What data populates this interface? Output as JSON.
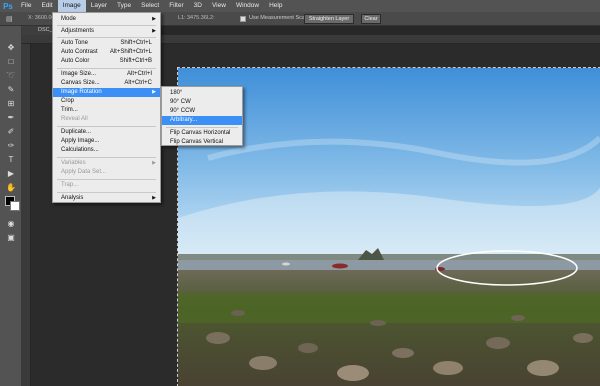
{
  "menubar": {
    "logo": "Ps",
    "items": [
      "File",
      "Edit",
      "Image",
      "Layer",
      "Type",
      "Select",
      "Filter",
      "3D",
      "View",
      "Window",
      "Help"
    ]
  },
  "options_bar": {
    "x_label": "X: 3600.00",
    "l1_label": "L1:",
    "l1_value": "3475.36",
    "l2_label": "L2:",
    "use_measurement_scale": "Use Measurement Scale",
    "straighten_button": "Straighten Layer",
    "clear_button": "Clear"
  },
  "document": {
    "tab_title": "DSC_"
  },
  "image_menu": {
    "mode": "Mode",
    "adjustments": "Adjustments",
    "auto_tone": {
      "label": "Auto Tone",
      "shortcut": "Shift+Ctrl+L"
    },
    "auto_contrast": {
      "label": "Auto Contrast",
      "shortcut": "Alt+Shift+Ctrl+L"
    },
    "auto_color": {
      "label": "Auto Color",
      "shortcut": "Shift+Ctrl+B"
    },
    "image_size": {
      "label": "Image Size...",
      "shortcut": "Alt+Ctrl+I"
    },
    "canvas_size": {
      "label": "Canvas Size...",
      "shortcut": "Alt+Ctrl+C"
    },
    "image_rotation": "Image Rotation",
    "crop": "Crop",
    "trim": "Trim...",
    "reveal_all": "Reveal All",
    "duplicate": "Duplicate...",
    "apply_image": "Apply Image...",
    "calculations": "Calculations...",
    "variables": "Variables",
    "apply_data_set": "Apply Data Set...",
    "trap": "Trap...",
    "analysis": "Analysis"
  },
  "rotation_menu": {
    "r180": "180°",
    "cw": "90° CW",
    "ccw": "90° CCW",
    "arbitrary": "Arbitrary...",
    "flip_h": "Flip Canvas Horizontal",
    "flip_v": "Flip Canvas Vertical"
  },
  "colors": {
    "menu_highlight": "#3b8ff5",
    "sky_top": "#3f8fd8",
    "sky_bottom": "#cfe6f5",
    "ellipse": "#ffffff"
  }
}
